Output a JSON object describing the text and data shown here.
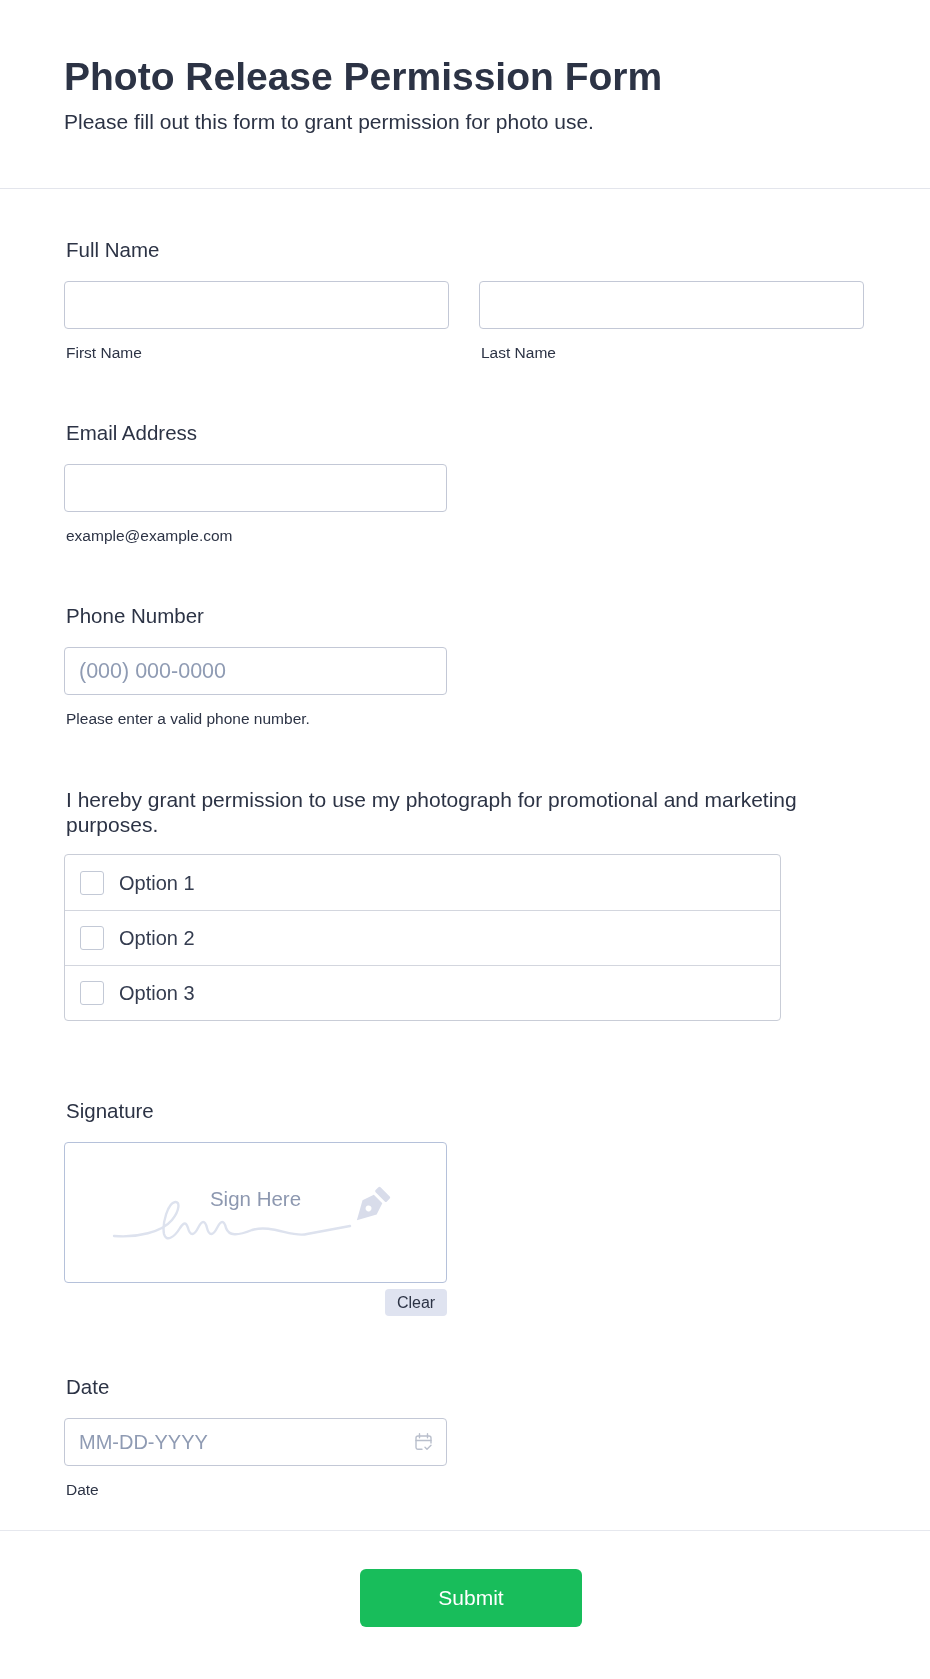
{
  "header": {
    "title": "Photo Release Permission Form",
    "subtitle": "Please fill out this form to grant permission for photo use."
  },
  "fields": [
    {
      "kind": "name",
      "label": "Full Name",
      "parts": [
        {
          "sublabel": "First Name"
        },
        {
          "sublabel": "Last Name"
        }
      ]
    },
    {
      "kind": "text",
      "label": "Email Address",
      "sublabel": "example@example.com"
    },
    {
      "kind": "text",
      "label": "Phone Number",
      "placeholder": "(000) 000-0000",
      "sublabel": "Please enter a valid phone number."
    },
    {
      "kind": "checkboxes",
      "label": "I hereby grant permission to use my photograph for promotional and marketing purposes.",
      "options": [
        {
          "label": "Option 1",
          "checked": false
        },
        {
          "label": "Option 2",
          "checked": false
        },
        {
          "label": "Option 3",
          "checked": false
        }
      ]
    },
    {
      "kind": "signature",
      "label": "Signature",
      "placeholder": "Sign Here",
      "clear_button": "Clear"
    },
    {
      "kind": "date",
      "label": "Date",
      "placeholder": "MM-DD-YYYY",
      "sublabel": "Date"
    }
  ],
  "submit_button": "Submit"
}
